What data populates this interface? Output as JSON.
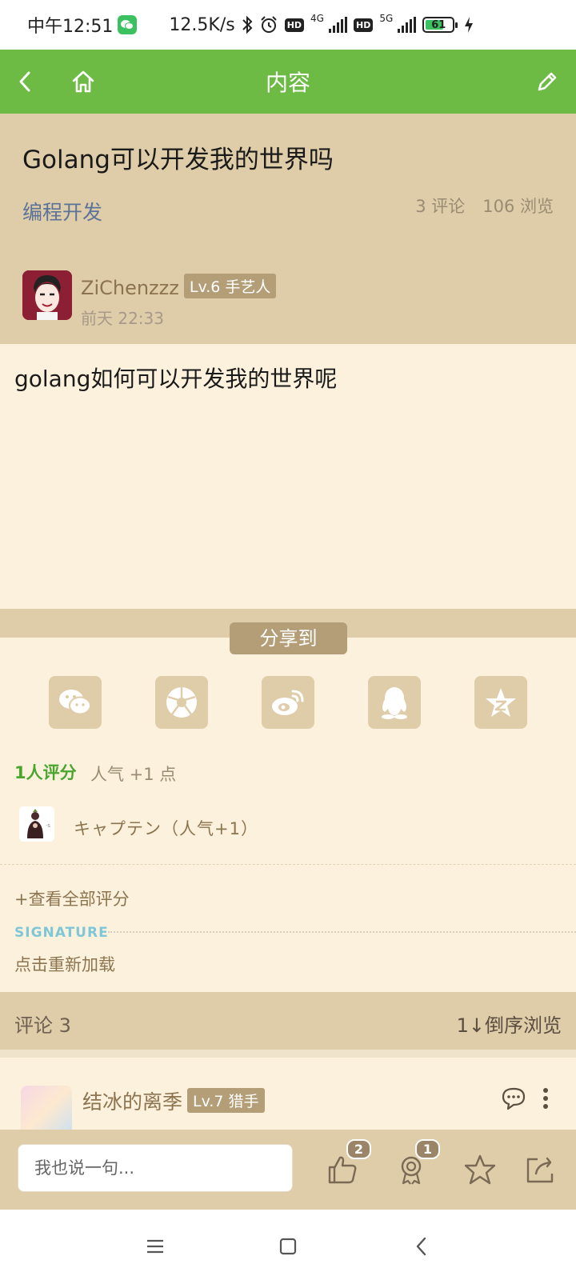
{
  "status_bar": {
    "time": "中午12:51",
    "net_speed": "12.5K/s",
    "hd_label": "HD",
    "net1": "4G",
    "net2": "5G",
    "battery": "61"
  },
  "app_bar": {
    "title": "内容"
  },
  "post": {
    "title": "Golang可以开发我的世界吗",
    "category": "编程开发",
    "comments_stat": "3 评论",
    "views_stat": "106 浏览",
    "author": {
      "name": "ZiChenzzz",
      "level": "Lv.6 手艺人",
      "time": "前天 22:33"
    },
    "body": "golang如何可以开发我的世界呢"
  },
  "share": {
    "label": "分享到",
    "targets": [
      {
        "name": "wechat",
        "icon": "wechat-icon"
      },
      {
        "name": "moments",
        "icon": "moments-icon"
      },
      {
        "name": "weibo",
        "icon": "weibo-icon"
      },
      {
        "name": "qq",
        "icon": "qq-icon"
      },
      {
        "name": "qzone",
        "icon": "qzone-icon"
      }
    ]
  },
  "ratings": {
    "count_label": "1人评分",
    "popularity": "人气 +1 点",
    "items": [
      {
        "name": "キャプテン（人气+1）"
      }
    ],
    "view_all": "+查看全部评分"
  },
  "signature": {
    "label": "SIGNATURE",
    "reload": "点击重新加载"
  },
  "comments": {
    "title": "评论 3",
    "sort": "1↓倒序浏览",
    "first": {
      "name": "结冰的离季",
      "level": "Lv.7 猎手"
    }
  },
  "bottom_bar": {
    "input_placeholder": "我也说一句...",
    "like_count": "2",
    "award_count": "1"
  },
  "colors": {
    "app_bar": "#6dbb45",
    "header_bg": "#dfcca8",
    "page_bg": "#fbf1dc",
    "accent_brown": "#b39e77",
    "rating_green": "#4aa52f"
  }
}
